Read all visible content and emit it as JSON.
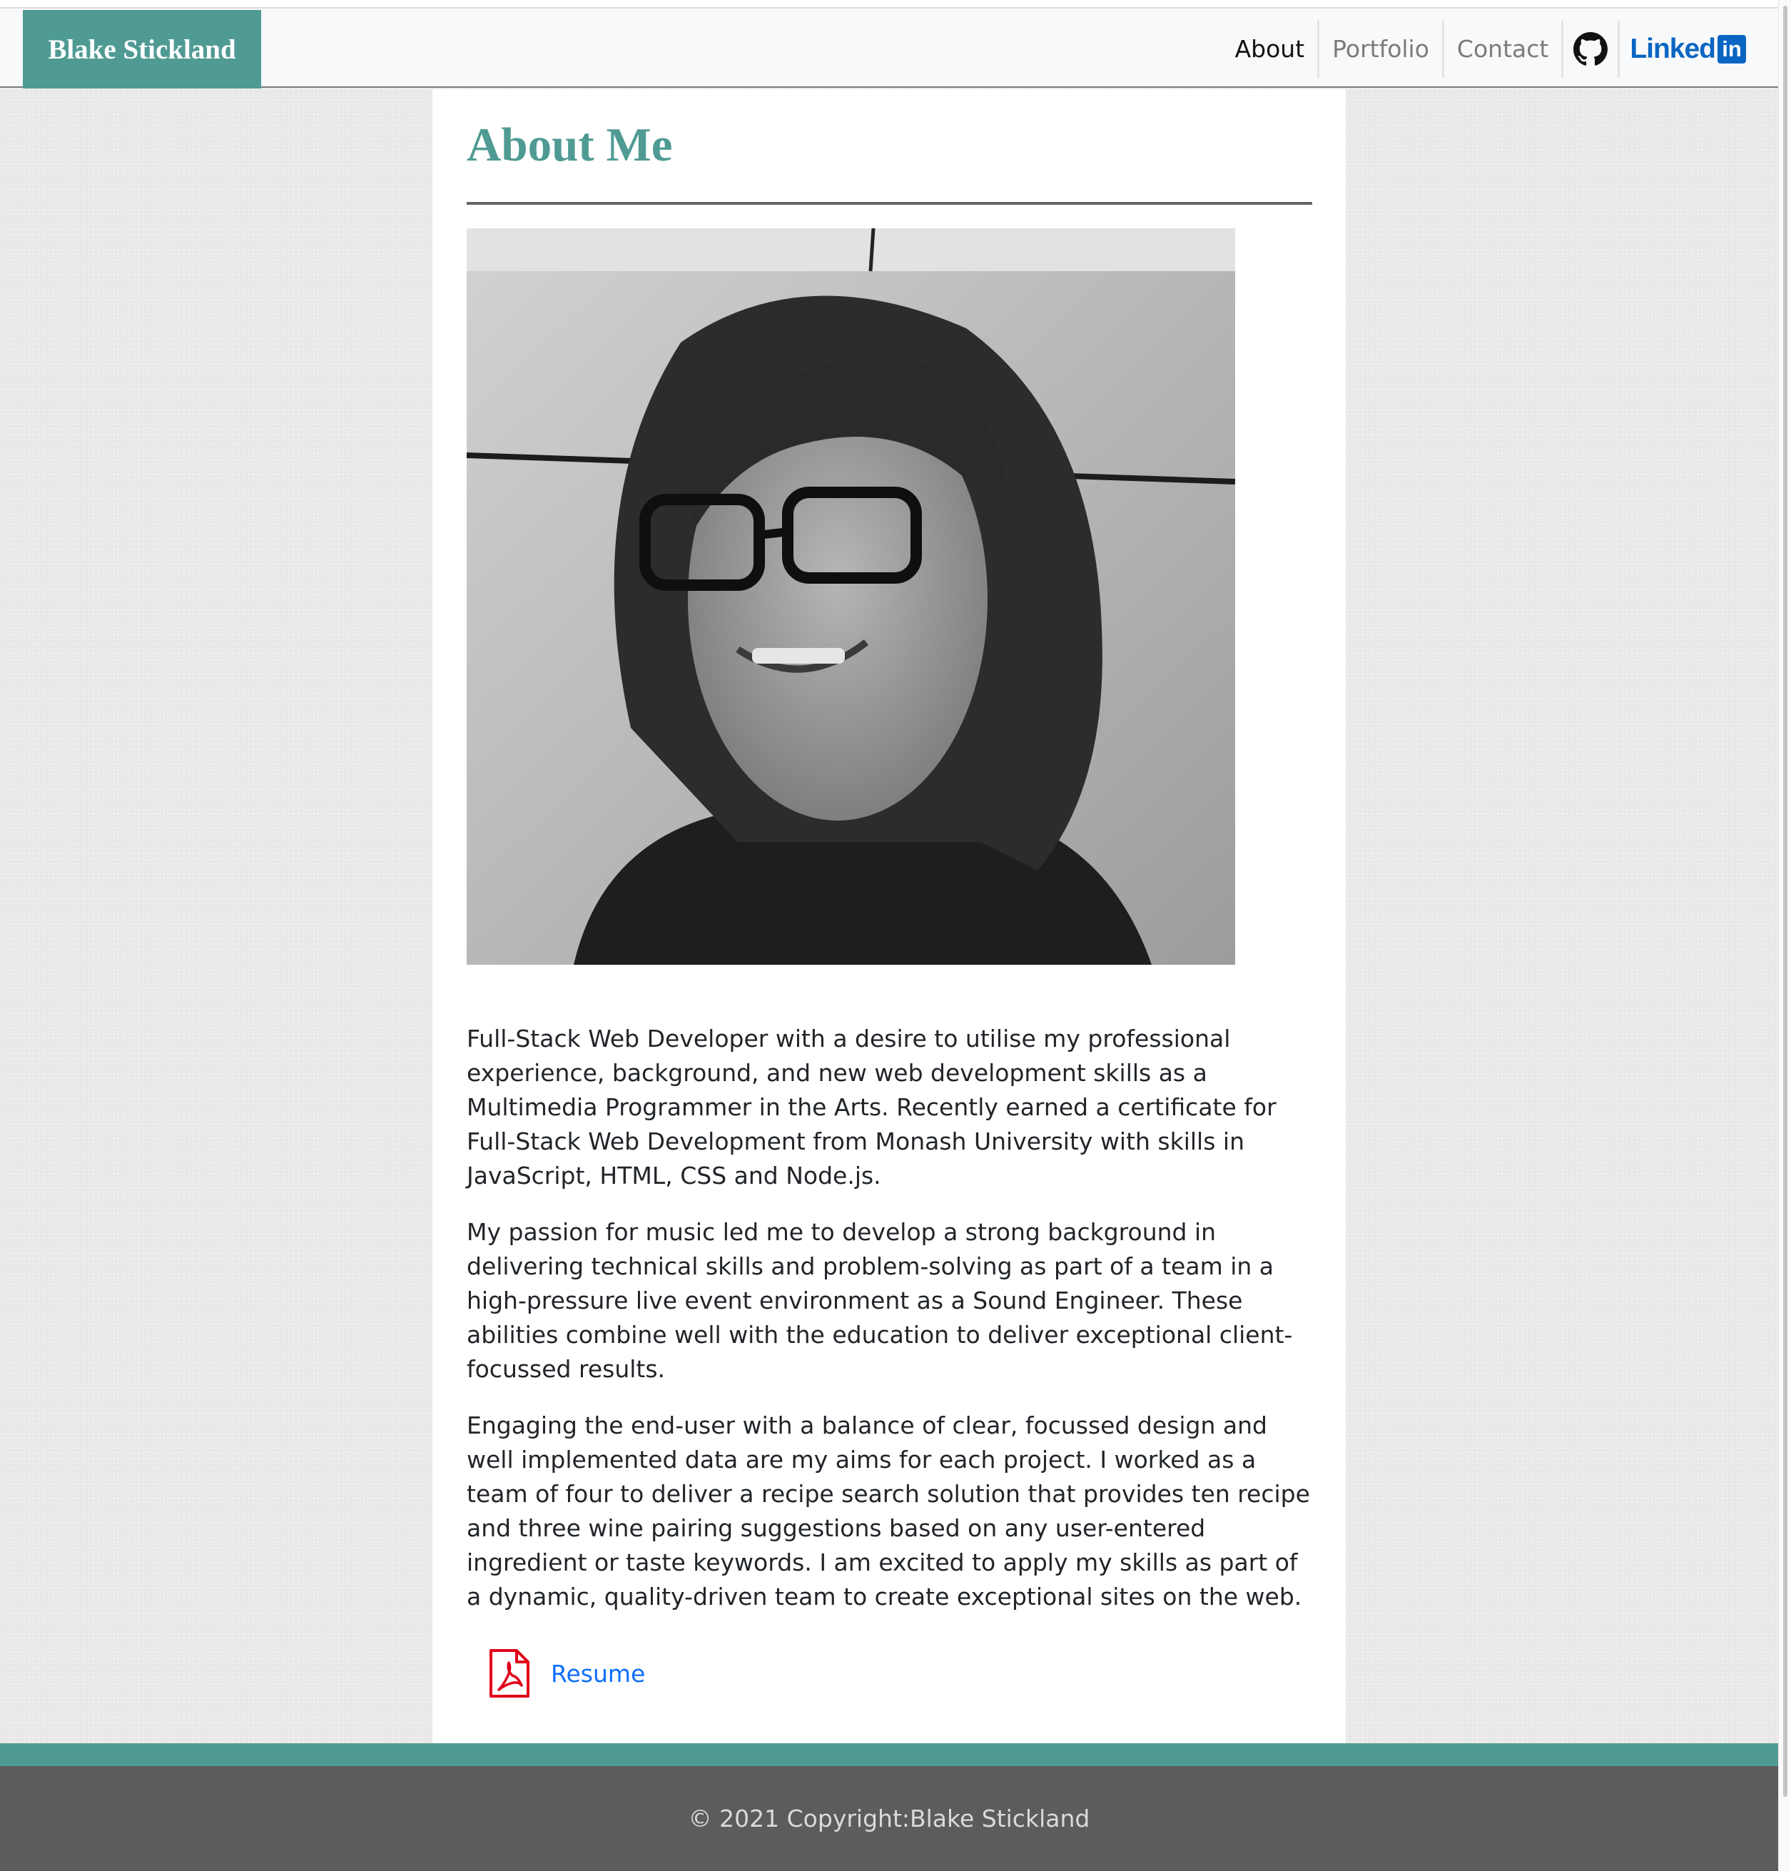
{
  "navbar": {
    "brand": "Blake Stickland",
    "links": [
      {
        "label": "About",
        "active": true
      },
      {
        "label": "Portfolio",
        "active": false
      },
      {
        "label": "Contact",
        "active": false
      }
    ],
    "github_icon": "github-icon",
    "linkedin": {
      "word": "Linked",
      "box": "in",
      "icon": "linkedin-icon"
    }
  },
  "main": {
    "title": "About Me",
    "portrait_icon": "profile-photo",
    "paragraphs": [
      "Full-Stack Web Developer with a desire to utilise my professional experience, background, and new web development skills as a Multimedia Programmer in the Arts. Recently earned a certificate for Full-Stack Web Development from Monash University with skills in JavaScript, HTML, CSS and Node.js.",
      "My passion for music led me to develop a strong background in delivering technical skills and problem-solving as part of a team in a high-pressure live event environment as a Sound Engineer. These abilities combine well with the education to deliver exceptional client-focussed results.",
      "Engaging the end-user with a balance of clear, focussed design and well implemented data are my aims for each project. I worked as a team of four to deliver a recipe search solution that provides ten recipe and three wine pairing suggestions based on any user-entered ingredient or taste keywords. I am excited to apply my skills as part of a dynamic, quality-driven team to create exceptional sites on the web."
    ],
    "resume": {
      "label": "Resume",
      "icon": "pdf-icon"
    }
  },
  "footer": {
    "text": "© 2021 Copyright:Blake Stickland"
  },
  "colors": {
    "accent": "#4f9b94",
    "link": "#0d6efd",
    "footer_bg": "#5c5c5c",
    "pdf_red": "#e2001a",
    "linkedin_blue": "#0a66c2"
  }
}
